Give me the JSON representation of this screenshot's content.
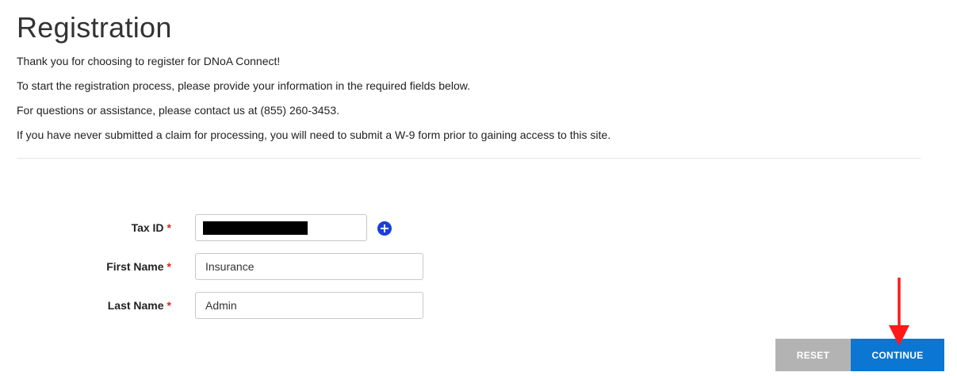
{
  "page": {
    "title": "Registration"
  },
  "intro": {
    "lines": [
      "Thank you for choosing to register for DNoA Connect!",
      "To start the registration process, please provide your information in the required fields below.",
      "For questions or assistance, please contact us at (855) 260-3453.",
      "If you have never submitted a claim for processing, you will need to submit a W-9 form prior to gaining access to this site."
    ]
  },
  "form": {
    "required_marker": "*",
    "tax_id": {
      "label": "Tax ID",
      "value": ""
    },
    "first_name": {
      "label": "First Name",
      "value": "Insurance"
    },
    "last_name": {
      "label": "Last Name",
      "value": "Admin"
    }
  },
  "buttons": {
    "reset": "RESET",
    "continue": "CONTINUE"
  },
  "icons": {
    "add": "plus-circle-icon",
    "annotation": "red-arrow-down-icon"
  },
  "colors": {
    "required": "#e0251b",
    "primary": "#0b77d2",
    "secondary": "#b3b3b3",
    "add_icon": "#1a3fd6",
    "annotation": "#ff1a1a"
  }
}
